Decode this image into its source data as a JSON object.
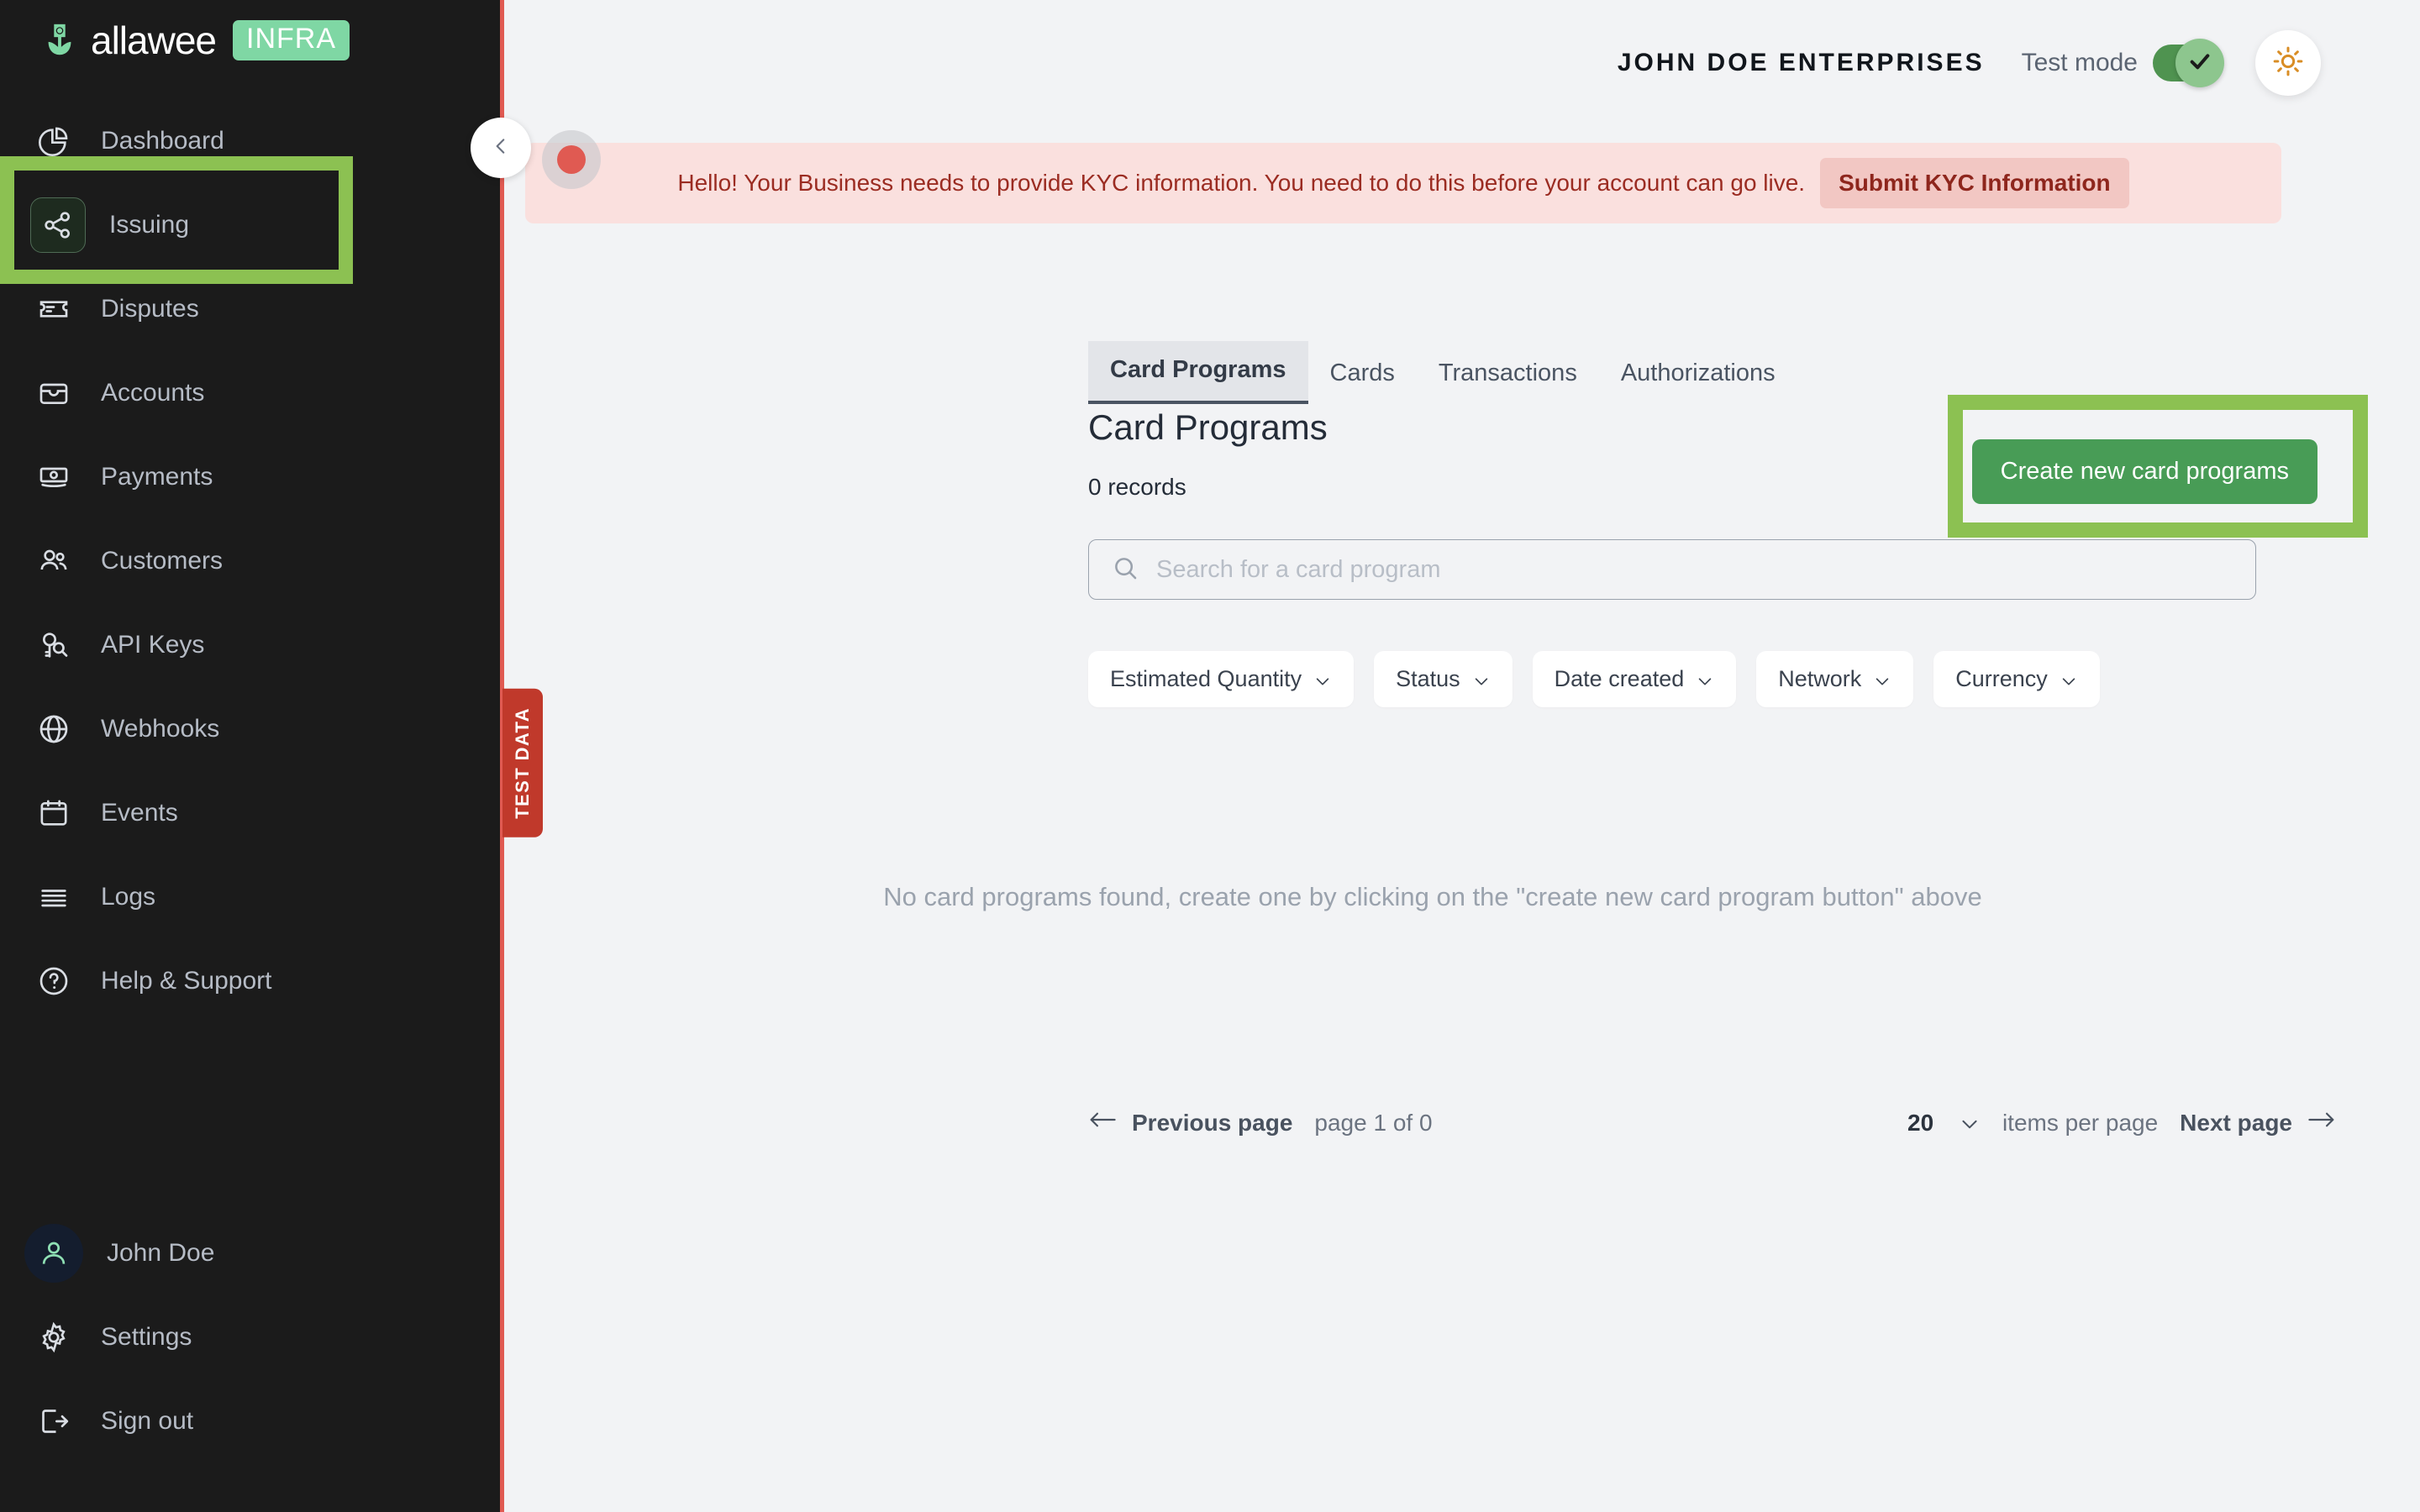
{
  "brand": {
    "name": "allawee",
    "badge": "INFRA",
    "logo_icon": "allawee-logo-icon"
  },
  "sidebar": {
    "items": [
      {
        "label": "Dashboard",
        "icon": "pie-chart-icon",
        "active": false
      },
      {
        "label": "Issuing",
        "icon": "share-nodes-icon",
        "active": true
      },
      {
        "label": "Disputes",
        "icon": "ticket-icon",
        "active": false
      },
      {
        "label": "Accounts",
        "icon": "wallet-icon",
        "active": false
      },
      {
        "label": "Payments",
        "icon": "banknote-icon",
        "active": false
      },
      {
        "label": "Customers",
        "icon": "users-icon",
        "active": false
      },
      {
        "label": "API Keys",
        "icon": "key-icon",
        "active": false
      },
      {
        "label": "Webhooks",
        "icon": "globe-icon",
        "active": false
      },
      {
        "label": "Events",
        "icon": "calendar-icon",
        "active": false
      },
      {
        "label": "Logs",
        "icon": "lines-icon",
        "active": false
      },
      {
        "label": "Help & Support",
        "icon": "question-circle-icon",
        "active": false
      }
    ],
    "bottom_items": [
      {
        "label": "John Doe",
        "icon": "user-avatar-icon"
      },
      {
        "label": "Settings",
        "icon": "gear-icon"
      },
      {
        "label": "Sign out",
        "icon": "sign-out-icon"
      }
    ],
    "test_data_tab": "TEST DATA",
    "collapse_icon": "chevron-left-icon"
  },
  "header": {
    "org_name": "JOHN DOE ENTERPRISES",
    "test_mode_label": "Test mode",
    "test_mode_on": true,
    "theme_icon": "sun-icon"
  },
  "banner": {
    "message": "Hello! Your Business needs to provide KYC information. You need to do this before your account can go live.",
    "cta_label": "Submit KYC Information"
  },
  "tabs": [
    {
      "label": "Card Programs",
      "active": true
    },
    {
      "label": "Cards",
      "active": false
    },
    {
      "label": "Transactions",
      "active": false
    },
    {
      "label": "Authorizations",
      "active": false
    }
  ],
  "main": {
    "page_title": "Card Programs",
    "records_text": "0 records",
    "search_placeholder": "Search for a card program",
    "search_value": "",
    "search_icon": "search-icon",
    "create_button_label": "Create new card programs",
    "empty_state": "No card programs found, create one by clicking on the \"create new card program button\" above"
  },
  "filters": [
    {
      "label": "Estimated Quantity"
    },
    {
      "label": "Status"
    },
    {
      "label": "Date created"
    },
    {
      "label": "Network"
    },
    {
      "label": "Currency"
    }
  ],
  "pagination": {
    "previous_label": "Previous page",
    "page_info": "page 1 of 0",
    "items_per_page_value": "20",
    "items_per_page_label": "items per page",
    "next_label": "Next page"
  },
  "colors": {
    "brand_green": "#7fd7a4",
    "accent_green": "#489c56",
    "highlight_green": "#8cc152",
    "sidebar_bg": "#1b1b1b",
    "page_bg": "#f2f3f5",
    "banner_bg": "#fae0de",
    "banner_text": "#9b2c22",
    "test_data_red": "#c0392b",
    "theme_icon_orange": "#d98d25"
  }
}
